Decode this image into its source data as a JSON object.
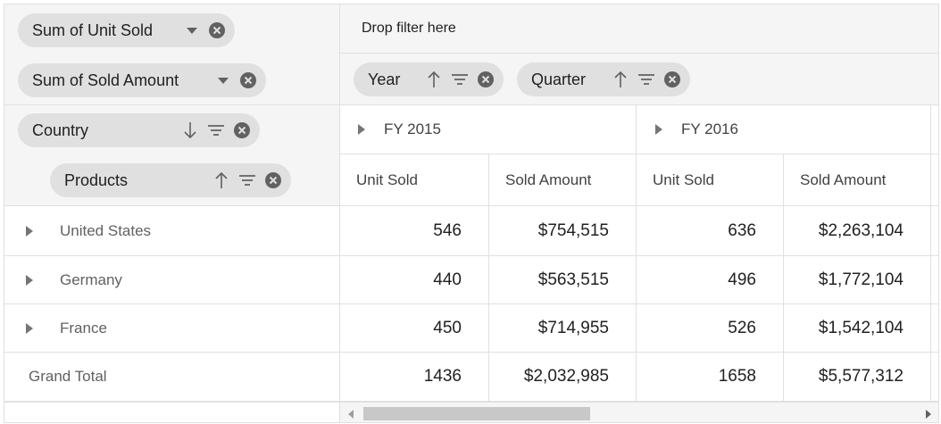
{
  "values_bar": {
    "pills": [
      {
        "label": "Sum of Unit Sold",
        "dropdown_icon": "caret-down-icon",
        "remove_icon": "remove-circle-icon"
      },
      {
        "label": "Sum of Sold Amount",
        "dropdown_icon": "caret-down-icon",
        "remove_icon": "remove-circle-icon"
      }
    ]
  },
  "filter_bar": {
    "hint": "Drop filter here"
  },
  "columns_bar": {
    "pills": [
      {
        "label": "Year",
        "sort": "ascending",
        "filter_icon": "filter-icon",
        "remove_icon": "remove-circle-icon"
      },
      {
        "label": "Quarter",
        "sort": "ascending",
        "filter_icon": "filter-icon",
        "remove_icon": "remove-circle-icon"
      }
    ]
  },
  "rows_bar": {
    "pills": [
      {
        "label": "Country",
        "sort": "descending",
        "filter_icon": "filter-icon",
        "remove_icon": "remove-circle-icon"
      },
      {
        "label": "Products",
        "sort": "ascending",
        "filter_icon": "filter-icon",
        "remove_icon": "remove-circle-icon"
      }
    ]
  },
  "grid": {
    "column_groups": [
      "FY 2015",
      "FY 2016"
    ],
    "measures": [
      "Unit Sold",
      "Sold Amount",
      "Unit Sold",
      "Sold Amount"
    ],
    "rows": [
      {
        "label": "United States",
        "expandable": true,
        "values": [
          "546",
          "$754,515",
          "636",
          "$2,263,104"
        ]
      },
      {
        "label": "Germany",
        "expandable": true,
        "values": [
          "440",
          "$563,515",
          "496",
          "$1,772,104"
        ]
      },
      {
        "label": "France",
        "expandable": true,
        "values": [
          "450",
          "$714,955",
          "526",
          "$1,542,104"
        ]
      },
      {
        "label": "Grand Total",
        "expandable": false,
        "values": [
          "1436",
          "$2,032,985",
          "1658",
          "$5,577,312"
        ]
      }
    ]
  },
  "colors": {
    "pill_bg": "#e0e0e0",
    "zone_bg": "#f5f5f5",
    "border": "#e0e0e0",
    "icon": "#616161"
  }
}
